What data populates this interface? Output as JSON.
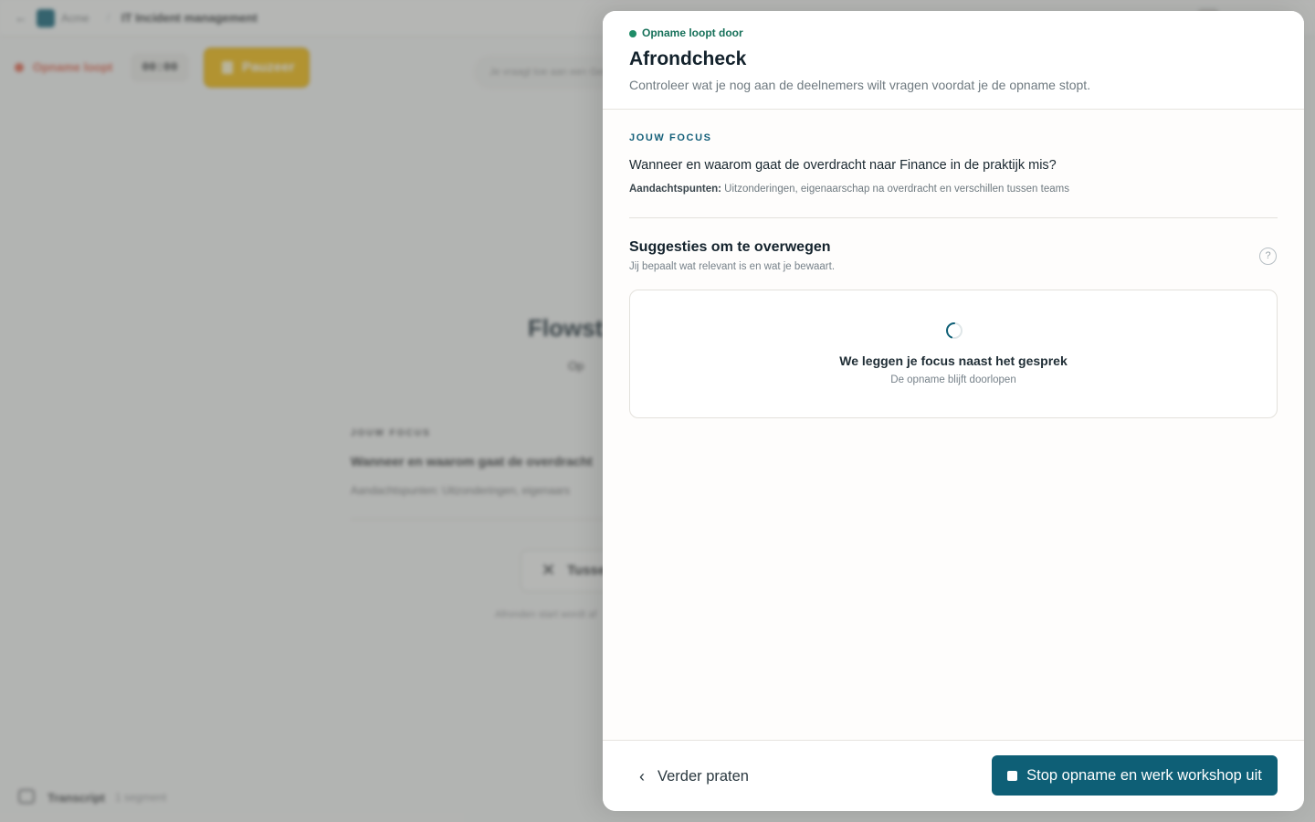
{
  "background": {
    "org_name": "Acme",
    "breadcrumb": "IT Incident management",
    "recording_label": "Opname loopt",
    "timer": "00:00",
    "pause_label": "Pauzeer",
    "ask_placeholder": "Je vraagt toe aan een Gesprek",
    "title": "Flowst",
    "status": "Op",
    "focus_label": "JOUW FOCUS",
    "focus_question": "Wanneer en waarom gaat de overdracht",
    "focus_points": "Aandachtspunten: Uitzonderingen, eigenaars",
    "timestamp_button": "Tusse",
    "note": "Afronden start wordt af",
    "transcript_label": "Transcript",
    "segment_count": "1 segment"
  },
  "panel": {
    "status": "Opname loopt door",
    "title": "Afrondcheck",
    "subtitle": "Controleer wat je nog aan de deelnemers wilt vragen voordat je de opname stopt.",
    "focus": {
      "label": "JOUW FOCUS",
      "question": "Wanneer en waarom gaat de overdracht naar Finance in de praktijk mis?",
      "points_label": "Aandachtspunten:",
      "points_text": "Uitzonderingen, eigenaarschap na overdracht en verschillen tussen teams"
    },
    "suggestions": {
      "title": "Suggesties om te overwegen",
      "subtitle": "Jij bepaalt wat relevant is en wat je bewaart.",
      "help_icon": "question-circle-icon",
      "loading_title": "We leggen je focus naast het gesprek",
      "loading_subtitle": "De opname blijft doorlopen"
    },
    "footer": {
      "back_label": "Verder praten",
      "stop_label": "Stop opname en werk workshop uit"
    }
  },
  "colors": {
    "accent": "#0e5f76",
    "status_green": "#1f8c67",
    "recording_red": "#e0624a",
    "pause_yellow": "#f2b705"
  }
}
